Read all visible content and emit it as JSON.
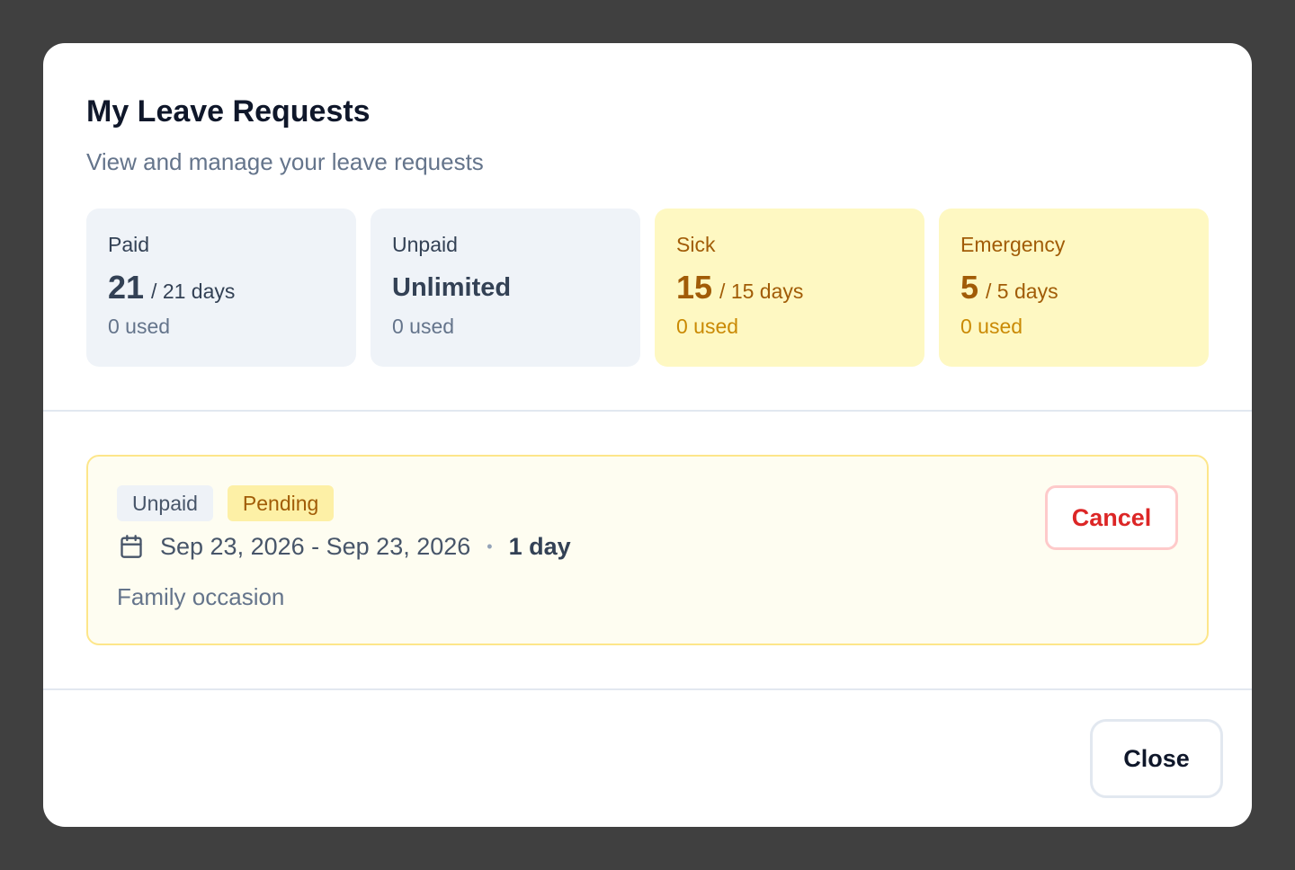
{
  "modal": {
    "title": "My Leave Requests",
    "subtitle": "View and manage your leave requests"
  },
  "balances": [
    {
      "label": "Paid",
      "value": "21",
      "total": "/ 21 days",
      "used": "0 used"
    },
    {
      "label": "Unpaid",
      "value": "Unlimited",
      "used": "0 used"
    },
    {
      "label": "Sick",
      "value": "15",
      "total": "/ 15 days",
      "used": "0 used"
    },
    {
      "label": "Emergency",
      "value": "5",
      "total": "/ 5 days",
      "used": "0 used"
    }
  ],
  "requests": [
    {
      "type": "Unpaid",
      "status": "Pending",
      "date_range": "Sep 23, 2026 - Sep 23, 2026",
      "separator": "•",
      "duration": "1 day",
      "reason": "Family occasion",
      "cancel_label": "Cancel"
    }
  ],
  "footer": {
    "close_label": "Close"
  },
  "icons": {
    "calendar": "calendar-icon"
  },
  "colors": {
    "overlay": "#404040",
    "pending_accent": "#a15c07",
    "cancel_red": "#dc2626",
    "card_gray": "#eff3f8",
    "card_yellow": "#fef8c2"
  }
}
